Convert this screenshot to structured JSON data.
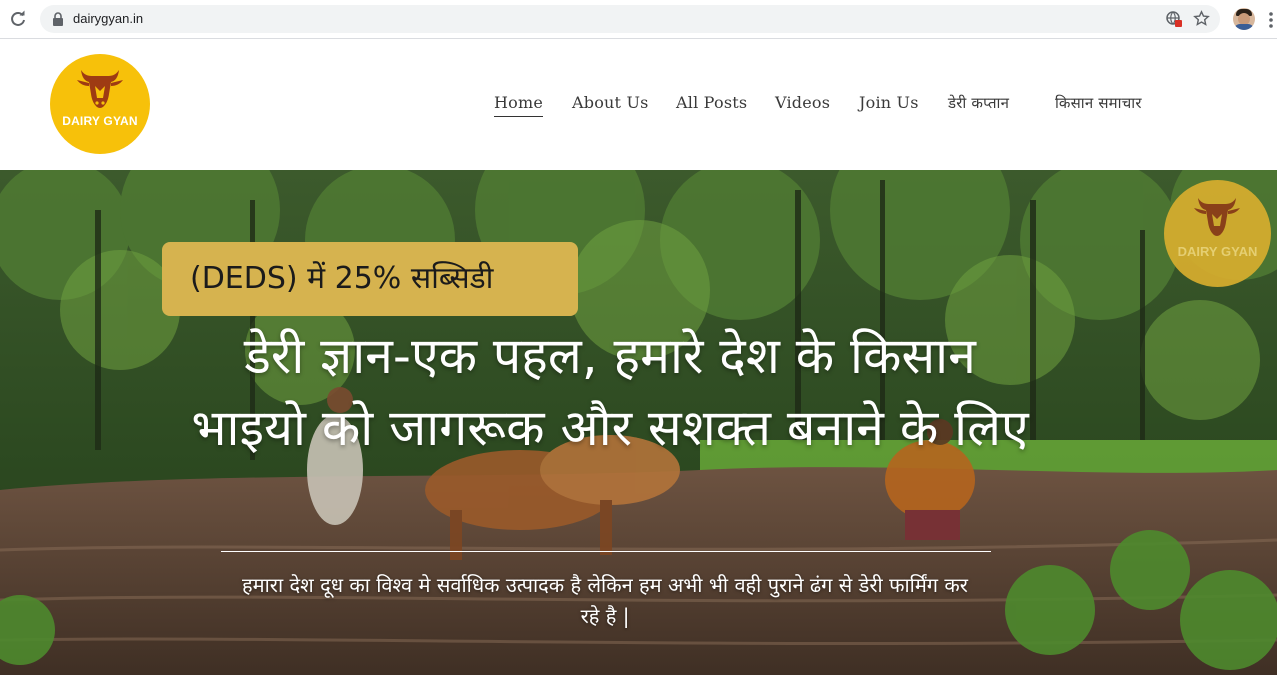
{
  "browser": {
    "url": "dairygyan.in",
    "icons": [
      "reload-icon",
      "lock-icon",
      "translate-icon",
      "star-icon",
      "profile-avatar",
      "kebab-menu-icon"
    ]
  },
  "site": {
    "logo_text": "DAIRY GYAN",
    "nav": [
      {
        "label": "Home",
        "active": true
      },
      {
        "label": "About Us"
      },
      {
        "label": "All Posts"
      },
      {
        "label": "Videos"
      },
      {
        "label": "Join Us"
      },
      {
        "label": "डेरी कप्तान"
      },
      {
        "label": "किसान समाचार"
      }
    ]
  },
  "hero": {
    "badge": "(DEDS) में 25% सब्सिडी",
    "corner_logo_text": "DAIRY GYAN",
    "headline": "डेरी ज्ञान-एक पहल, हमारे देश के किसान भाइयो को जागरूक और सशक्त बनाने के लिए",
    "subtitle": "हमारा देश दूध का विश्व मे सर्वाधिक उत्पादक है लेकिन हम अभी भी वही पुराने ढंग से डेरी फार्मिंग कर रहे है |"
  },
  "colors": {
    "logo_yellow": "#f7c10a",
    "badge_gold": "#d6b34f",
    "nav_text": "#3a3a3a",
    "forest_green": "#2f4a22"
  }
}
